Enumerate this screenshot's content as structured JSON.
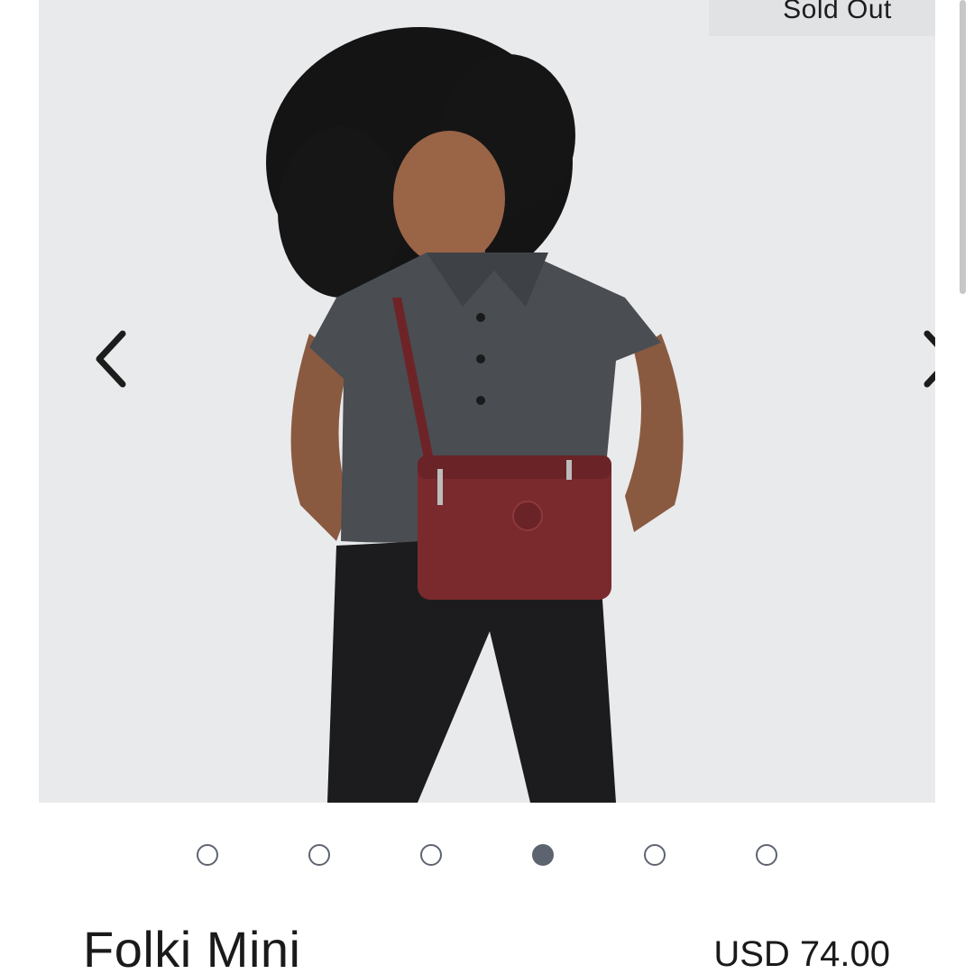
{
  "gallery": {
    "badge_label": "Sold Out",
    "prev_icon": "chevron-left-icon",
    "next_icon": "chevron-right-icon",
    "image_alt": "Model wearing a burgundy crossbody bag",
    "background_color": "#e9eaec",
    "bag_color": "#7a2a2d"
  },
  "carousel": {
    "total_slides": 6,
    "active_index": 3,
    "dot_color": "#5d6470"
  },
  "product": {
    "name": "Folki Mini",
    "price": "USD 74.00"
  }
}
